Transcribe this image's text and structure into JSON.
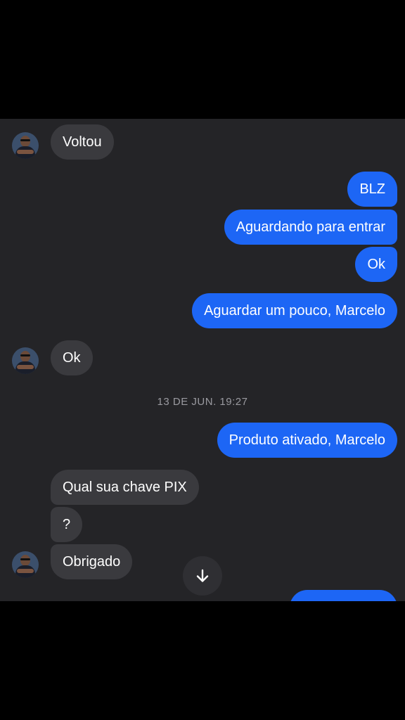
{
  "conversation": {
    "messages": [
      {
        "side": "in",
        "text": "Voltou"
      },
      {
        "side": "out",
        "text": "BLZ"
      },
      {
        "side": "out",
        "text": "Aguardando para entrar"
      },
      {
        "side": "out",
        "text": "Ok"
      },
      {
        "side": "out",
        "text": "Aguardar um pouco, Marcelo"
      },
      {
        "side": "in",
        "text": "Ok"
      },
      {
        "side": "out",
        "text": "Produto ativado, Marcelo"
      },
      {
        "side": "in",
        "text": "Qual sua chave PIX"
      },
      {
        "side": "in",
        "text": "?"
      },
      {
        "side": "in",
        "text": "Obrigado"
      }
    ],
    "timestamp": "13 DE JUN. 19:27"
  },
  "icons": {
    "scroll_down": "arrow-down-icon",
    "avatar": "contact-avatar"
  },
  "colors": {
    "incoming_bubble": "#3a3a3e",
    "outgoing_bubble": "#1d66f5",
    "chat_background": "#242427"
  }
}
